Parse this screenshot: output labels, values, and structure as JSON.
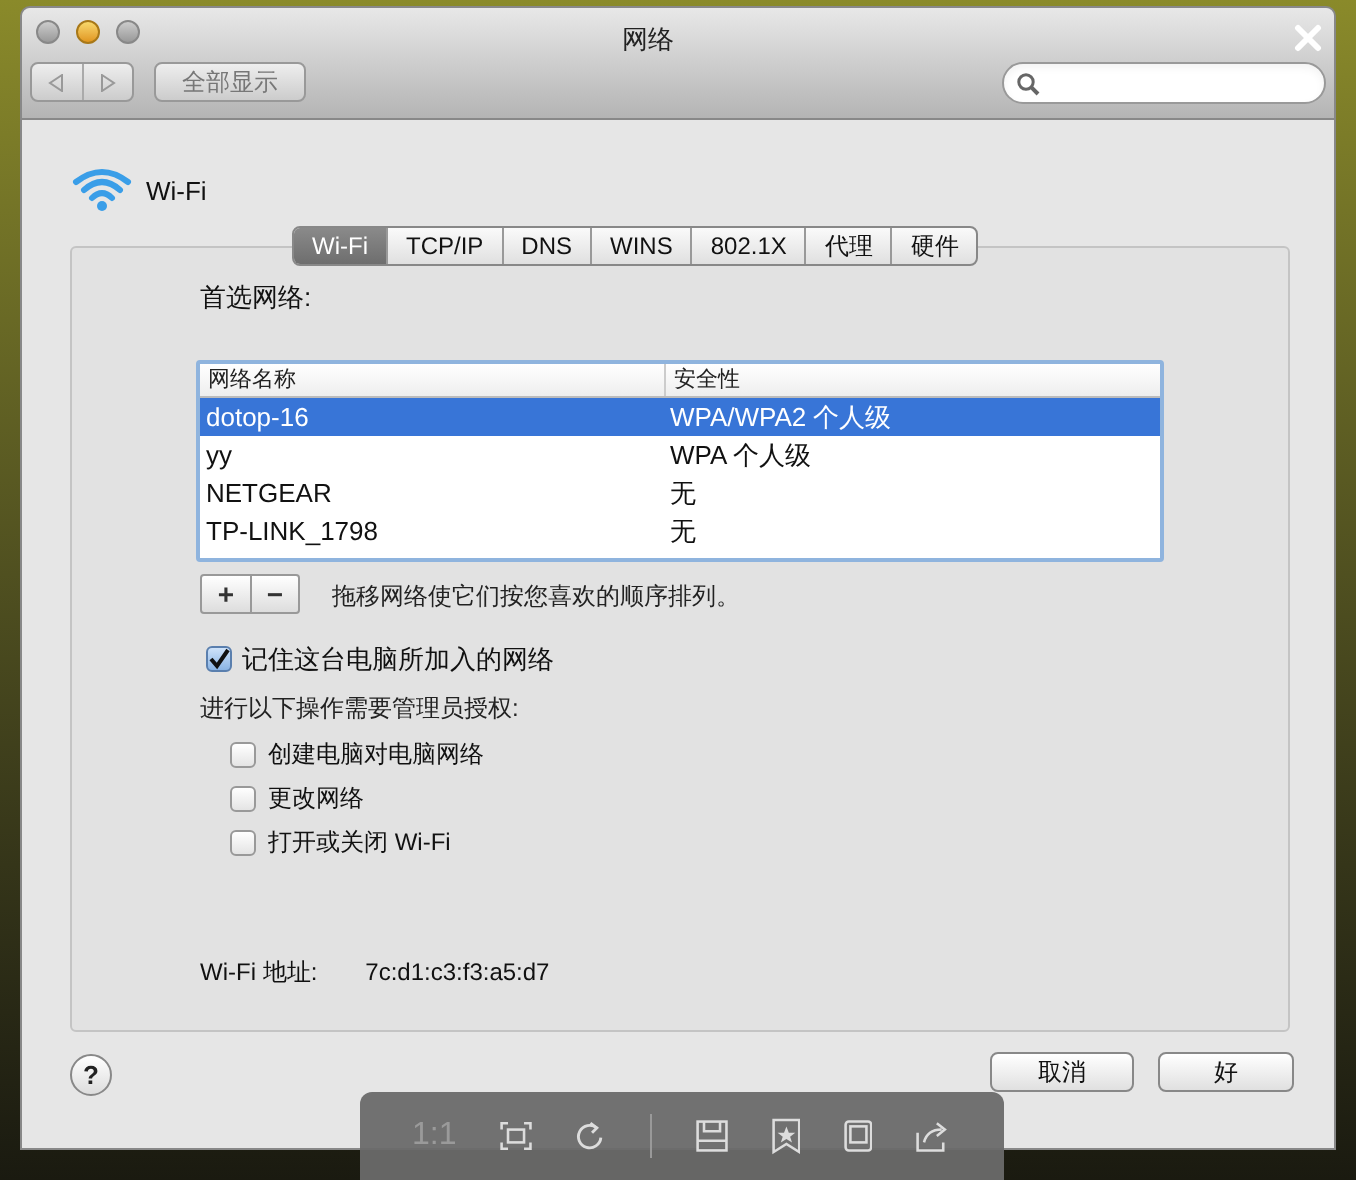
{
  "window": {
    "title": "网络"
  },
  "toolbar": {
    "show_all": "全部显示"
  },
  "header": {
    "name": "Wi-Fi"
  },
  "tabs": [
    {
      "label": "Wi-Fi",
      "selected": true
    },
    {
      "label": "TCP/IP",
      "selected": false
    },
    {
      "label": "DNS",
      "selected": false
    },
    {
      "label": "WINS",
      "selected": false
    },
    {
      "label": "802.1X",
      "selected": false
    },
    {
      "label": "代理",
      "selected": false
    },
    {
      "label": "硬件",
      "selected": false
    }
  ],
  "preferred_label": "首选网络:",
  "table": {
    "columns": [
      "网络名称",
      "安全性"
    ],
    "rows": [
      {
        "cells": [
          "dotop-16",
          "WPA/WPA2 个人级"
        ],
        "selected": true
      },
      {
        "cells": [
          "yy",
          "WPA 个人级"
        ],
        "selected": false
      },
      {
        "cells": [
          "NETGEAR",
          "无"
        ],
        "selected": false
      },
      {
        "cells": [
          "TP-LINK_1798",
          "无"
        ],
        "selected": false
      }
    ]
  },
  "list_buttons": [
    "+",
    "−"
  ],
  "hint": "拖移网络使它们按您喜欢的顺序排列。",
  "remember": {
    "label": "记住这台电脑所加入的网络",
    "checked": true
  },
  "admin_label": "进行以下操作需要管理员授权:",
  "admin_options": [
    {
      "label": "创建电脑对电脑网络",
      "checked": false
    },
    {
      "label": "更改网络",
      "checked": false
    },
    {
      "label": "打开或关闭 Wi-Fi",
      "checked": false
    }
  ],
  "address": {
    "label": "Wi-Fi 地址:",
    "value": "7c:d1:c3:f3:a5:d7"
  },
  "help": "?",
  "buttons": [
    "取消",
    "好"
  ],
  "viewer_toolbar": {
    "zoom_label": "1:1"
  }
}
